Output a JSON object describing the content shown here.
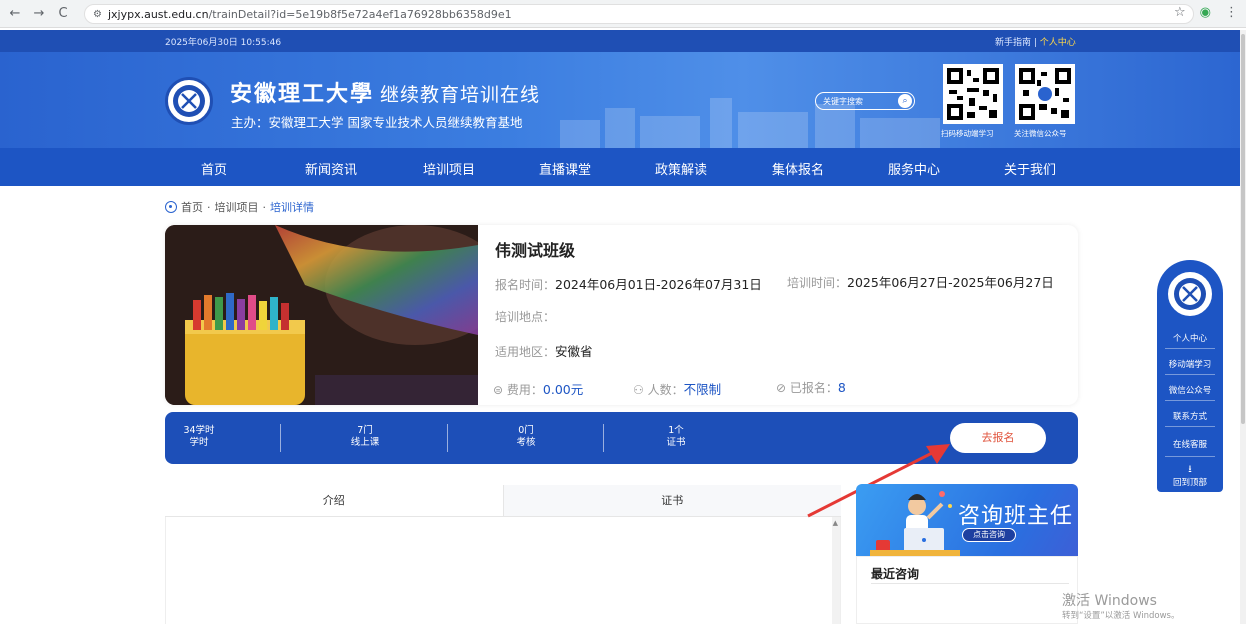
{
  "browser": {
    "back": "←",
    "forward": "→",
    "reload": "C",
    "url_host": "jxjypx.aust.edu.cn",
    "url_path": "/trainDetail?id=5e19b8f5e72a4ef1a76928bb6358d9e1",
    "star": "☆",
    "menu": "⋮"
  },
  "topbar": {
    "datetime": "2025年06月30日 10:55:46",
    "guide": "新手指南",
    "divider": " | ",
    "personal": "个人中心"
  },
  "header": {
    "brand": "安徽理工大學",
    "brand_sub": "继续教育培训在线",
    "host": "主办：安徽理工大学  国家专业技术人员继续教育基地",
    "search_placeholder": "关键字搜索",
    "qr1_caption": "扫码移动端学习",
    "qr2_caption": "关注微信公众号"
  },
  "nav": [
    "首页",
    "新闻资讯",
    "培训项目",
    "直播课堂",
    "政策解读",
    "集体报名",
    "服务中心",
    "关于我们"
  ],
  "breadcrumb": {
    "home": "首页",
    "sep1": " · ",
    "mid": "培训项目",
    "sep2": " · ",
    "current": "培训详情"
  },
  "course": {
    "title": "伟测试班级",
    "signup_label": "报名时间：",
    "signup_value": "2024年06月01日-2026年07月31日",
    "train_label": "培训时间：",
    "train_value": "2025年06月27日-2025年06月27日",
    "location_label": "培训地点：",
    "location_value": "",
    "region_label": "适用地区：",
    "region_value": "安徽省",
    "fee_label": "费用：",
    "fee_value": "0.00元",
    "people_label": "人数：",
    "people_value": "不限制",
    "enrolled_label": "已报名：",
    "enrolled_value": "8"
  },
  "stats": [
    {
      "value": "34学时",
      "label": "学时"
    },
    {
      "value": "7门",
      "label": "线上课"
    },
    {
      "value": "0门",
      "label": "考核"
    },
    {
      "value": "1个",
      "label": "证书"
    }
  ],
  "enroll_button": "去报名",
  "tabs": [
    "介绍",
    "证书"
  ],
  "consult": {
    "title": "咨询班主任",
    "button": "点击咨询",
    "recent": "最近咨询"
  },
  "side": {
    "items": [
      "个人中心",
      "移动端学习",
      "微信公众号",
      "联系方式",
      "在线客服",
      "回到顶部"
    ]
  },
  "watermark": {
    "line1": "激活 Windows",
    "line2": "转到“设置”以激活 Windows。"
  },
  "colors": {
    "brand_blue": "#1d55c4",
    "accent_red": "#e0533c",
    "highlight_yellow": "#ffd84a"
  }
}
